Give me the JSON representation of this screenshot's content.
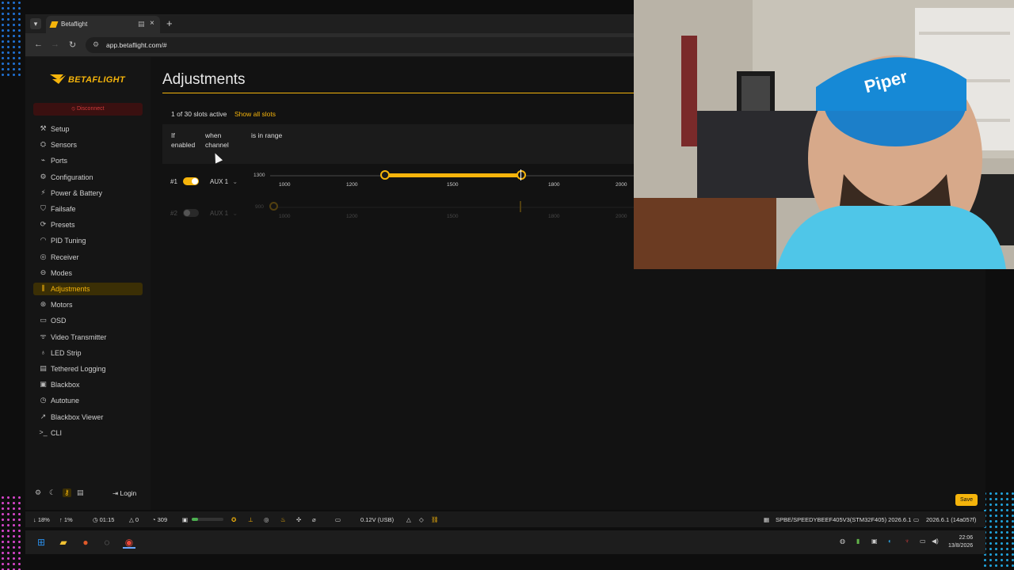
{
  "browser": {
    "tab_title": "Betaflight",
    "url": "app.betaflight.com/#"
  },
  "app": {
    "logo_text": "BETAFLIGHT",
    "disconnect_label": "Disconnect",
    "nav": [
      {
        "label": "Setup",
        "icon": "tool-icon"
      },
      {
        "label": "Sensors",
        "icon": "sensors-icon"
      },
      {
        "label": "Ports",
        "icon": "ports-icon"
      },
      {
        "label": "Configuration",
        "icon": "gear-icon"
      },
      {
        "label": "Power & Battery",
        "icon": "battery-icon"
      },
      {
        "label": "Failsafe",
        "icon": "shield-icon"
      },
      {
        "label": "Presets",
        "icon": "presets-icon"
      },
      {
        "label": "PID Tuning",
        "icon": "gauge-icon"
      },
      {
        "label": "Receiver",
        "icon": "receiver-icon"
      },
      {
        "label": "Modes",
        "icon": "toggle-icon"
      },
      {
        "label": "Adjustments",
        "icon": "sliders-icon"
      },
      {
        "label": "Motors",
        "icon": "motor-icon"
      },
      {
        "label": "OSD",
        "icon": "osd-icon"
      },
      {
        "label": "Video Transmitter",
        "icon": "antenna-icon"
      },
      {
        "label": "LED Strip",
        "icon": "bulb-icon"
      },
      {
        "label": "Tethered Logging",
        "icon": "log-icon"
      },
      {
        "label": "Blackbox",
        "icon": "blackbox-icon"
      },
      {
        "label": "Autotune",
        "icon": "autotune-icon"
      },
      {
        "label": "Blackbox Viewer",
        "icon": "chart-icon"
      },
      {
        "label": "CLI",
        "icon": "terminal-icon"
      }
    ],
    "active_nav": "Adjustments",
    "login_label": "Login"
  },
  "page": {
    "title": "Adjustments",
    "slots_active": "1 of 30 slots active",
    "show_all": "Show all slots",
    "headers": {
      "enabled_line1": "If",
      "enabled_line2": "enabled",
      "channel_line1": "when",
      "channel_line2": "channel",
      "range": "is in range"
    },
    "slots": [
      {
        "num": "#1",
        "enabled": true,
        "channel": "AUX 1",
        "range_min_label": "1300",
        "ticks": [
          "1000",
          "1200",
          "1500",
          "1800",
          "2000"
        ],
        "range_low": 1300,
        "range_high": 1700,
        "current": 1700
      },
      {
        "num": "#2",
        "enabled": false,
        "channel": "AUX 1",
        "range_min_label": "900",
        "ticks": [
          "1000",
          "1200",
          "1500",
          "1800",
          "2000"
        ],
        "current": 1700
      }
    ],
    "save_label": "Save"
  },
  "statusbar": {
    "cpu_down": "18%",
    "cpu_up": "1%",
    "arm_time": "01:15",
    "warnings": "0",
    "loop": "309",
    "voltage": "0.12V (USB)",
    "battery_level": 0.2,
    "board": "SPBE/SPEEDYBEEF405V3(STM32F405) 2026.6.1",
    "version": "2026.6.1 (14a057f)"
  },
  "taskbar": {
    "time": "22:06",
    "date": "13/8/2026"
  }
}
